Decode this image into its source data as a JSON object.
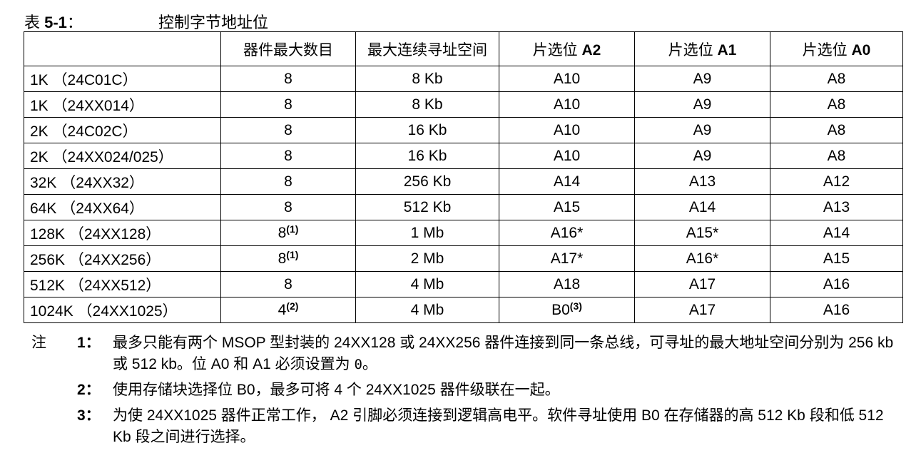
{
  "caption": {
    "label_prefix": "表 ",
    "label_number": "5-1",
    "label_suffix": "：",
    "title": "控制字节地址位"
  },
  "table": {
    "headers": [
      {
        "text": "",
        "bold": ""
      },
      {
        "text": "器件最大数目",
        "bold": ""
      },
      {
        "text": "最大连续寻址空间",
        "bold": ""
      },
      {
        "text": "片选位 ",
        "bold": "A2"
      },
      {
        "text": "片选位 ",
        "bold": "A1"
      },
      {
        "text": "片选位 ",
        "bold": "A0"
      }
    ],
    "rows": [
      {
        "device": "1K （24C01C）",
        "max": "8",
        "max_note": "",
        "space": "8 Kb",
        "a2": "A10",
        "a2_note": "",
        "a1": "A9",
        "a0": "A8"
      },
      {
        "device": "1K （24XX014）",
        "max": "8",
        "max_note": "",
        "space": "8 Kb",
        "a2": "A10",
        "a2_note": "",
        "a1": "A9",
        "a0": "A8"
      },
      {
        "device": "2K （24C02C）",
        "max": "8",
        "max_note": "",
        "space": "16 Kb",
        "a2": "A10",
        "a2_note": "",
        "a1": "A9",
        "a0": "A8"
      },
      {
        "device": "2K （24XX024/025）",
        "max": "8",
        "max_note": "",
        "space": "16 Kb",
        "a2": "A10",
        "a2_note": "",
        "a1": "A9",
        "a0": "A8"
      },
      {
        "device": "32K （24XX32）",
        "max": "8",
        "max_note": "",
        "space": "256 Kb",
        "a2": "A14",
        "a2_note": "",
        "a1": "A13",
        "a0": "A12"
      },
      {
        "device": "64K （24XX64）",
        "max": "8",
        "max_note": "",
        "space": "512 Kb",
        "a2": "A15",
        "a2_note": "",
        "a1": "A14",
        "a0": "A13"
      },
      {
        "device": "128K （24XX128）",
        "max": "8",
        "max_note": "(1)",
        "space": "1 Mb",
        "a2": "A16*",
        "a2_note": "",
        "a1": "A15*",
        "a0": "A14"
      },
      {
        "device": "256K （24XX256）",
        "max": "8",
        "max_note": "(1)",
        "space": "2 Mb",
        "a2": "A17*",
        "a2_note": "",
        "a1": "A16*",
        "a0": "A15"
      },
      {
        "device": "512K （24XX512）",
        "max": "8",
        "max_note": "",
        "space": "4 Mb",
        "a2": "A18",
        "a2_note": "",
        "a1": "A17",
        "a0": "A16"
      },
      {
        "device": "1024K （24XX1025）",
        "max": "4",
        "max_note": "(2)",
        "space": "4 Mb",
        "a2": "B0",
        "a2_note": "(3)",
        "a1": "A17",
        "a0": "A16"
      }
    ]
  },
  "notes": {
    "label": "注",
    "items": [
      {
        "num": "1：",
        "text": "最多只能有两个 MSOP 型封装的 24XX128 或 24XX256 器件连接到同一条总线，可寻址的最大地址空间分别为 256 kb 或 512 kb。位 A0 和 A1 必须设置为 ",
        "mono": "0",
        "tail": "。"
      },
      {
        "num": "2：",
        "text": "使用存储块选择位 B0，最多可将 4 个 24XX1025 器件级联在一起。",
        "mono": "",
        "tail": ""
      },
      {
        "num": "3：",
        "text": "为使 24XX1025 器件正常工作， A2 引脚必须连接到逻辑高电平。软件寻址使用 B0 在存储器的高 512 Kb 段和低 512 Kb 段之间进行选择。",
        "mono": "",
        "tail": ""
      }
    ]
  }
}
